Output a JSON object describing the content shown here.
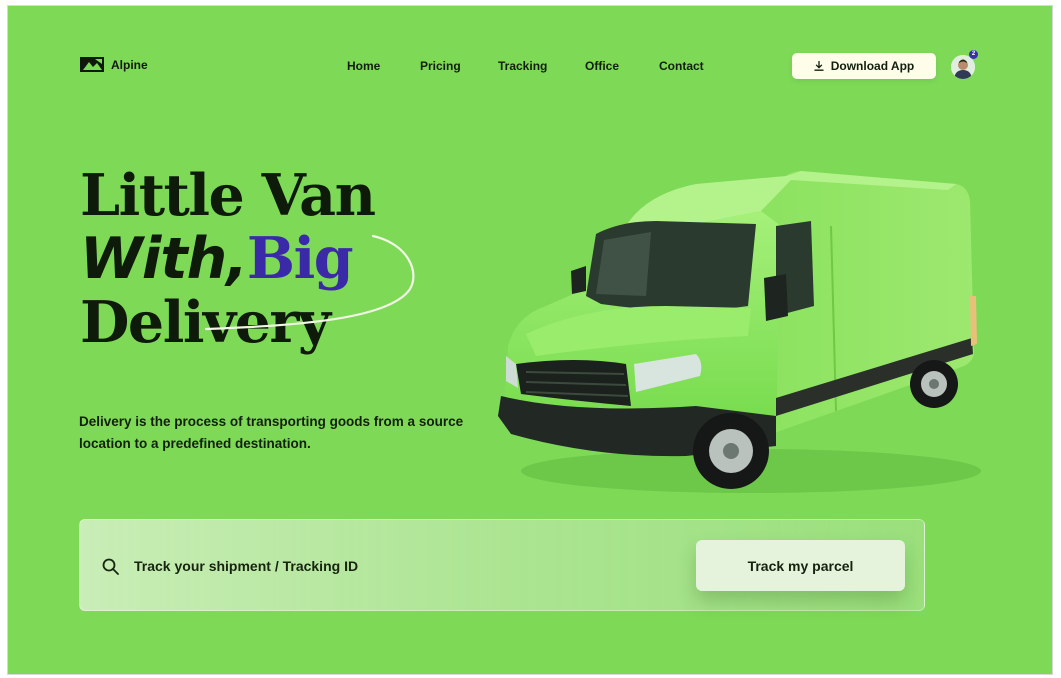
{
  "brand": {
    "name": "Alpine",
    "logo_icon": "mountain-logo-icon"
  },
  "nav": {
    "items": [
      {
        "label": "Home"
      },
      {
        "label": "Pricing"
      },
      {
        "label": "Tracking"
      },
      {
        "label": "Office"
      },
      {
        "label": "Contact"
      }
    ]
  },
  "header": {
    "download_label": "Download App",
    "download_icon": "download-icon",
    "avatar_badge": "2"
  },
  "hero": {
    "line1": "Little Van",
    "line2_italic": "With,",
    "line2_accent": "Big",
    "line3": "Delivery",
    "description": "Delivery is the process of transporting goods from a source location to a predefined destination."
  },
  "tracking": {
    "placeholder": "Track your shipment / Tracking ID",
    "button_label": "Track my parcel",
    "search_icon": "search-icon"
  },
  "colors": {
    "background": "#7ed957",
    "accent": "#3b2aa8",
    "text": "#0e1a0a",
    "button": "#fdfdea"
  }
}
